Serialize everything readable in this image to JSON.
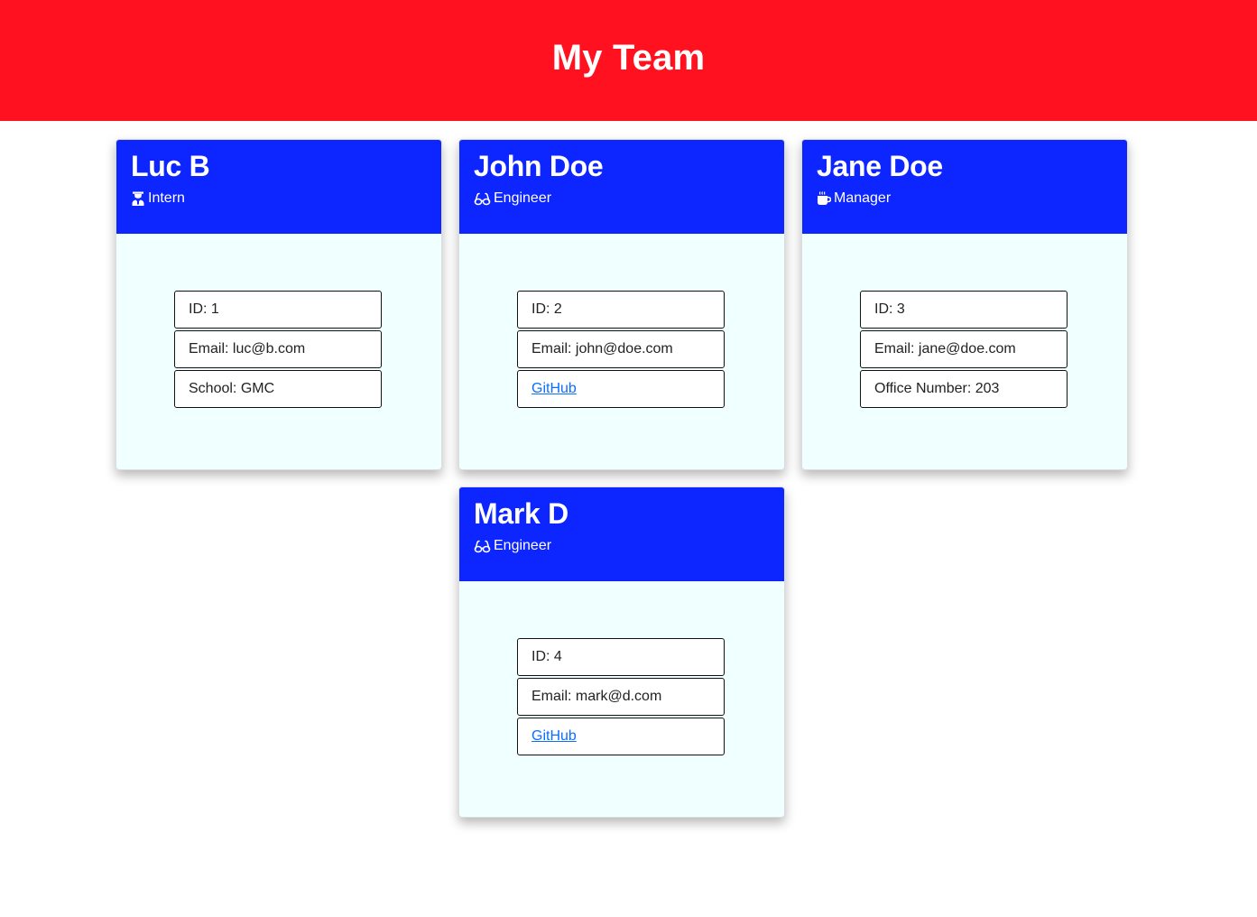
{
  "header": {
    "title": "My Team"
  },
  "team": [
    {
      "name": "Luc B",
      "role": "Intern",
      "role_icon": "graduate-icon",
      "id_text": "ID: 1",
      "email_text": "Email: luc@b.com",
      "extra_text": "School: GMC",
      "extra_is_link": false
    },
    {
      "name": "John Doe",
      "role": "Engineer",
      "role_icon": "glasses-icon",
      "id_text": "ID: 2",
      "email_text": "Email: john@doe.com",
      "extra_text": "GitHub",
      "extra_is_link": true
    },
    {
      "name": "Jane Doe",
      "role": "Manager",
      "role_icon": "coffee-icon",
      "id_text": "ID: 3",
      "email_text": "Email: jane@doe.com",
      "extra_text": "Office Number: 203",
      "extra_is_link": false
    },
    {
      "name": "Mark D",
      "role": "Engineer",
      "role_icon": "glasses-icon",
      "id_text": "ID: 4",
      "email_text": "Email: mark@d.com",
      "extra_text": "GitHub",
      "extra_is_link": true
    }
  ],
  "colors": {
    "header_bg": "#ff111f",
    "card_head_bg": "#0d25ff",
    "card_body_bg": "#f0ffff",
    "link": "#0d6efd"
  }
}
